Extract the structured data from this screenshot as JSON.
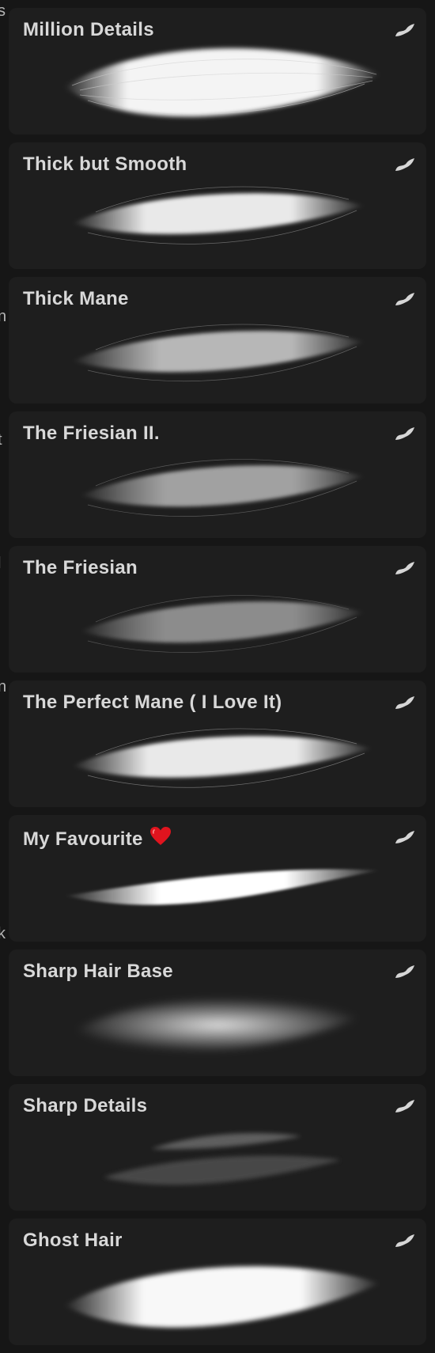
{
  "left_strip": [
    "s",
    "n",
    "t",
    "l",
    "n",
    "k"
  ],
  "brushes": [
    {
      "name": "Million Details",
      "icon": "procreate-brush-icon"
    },
    {
      "name": "Thick but Smooth",
      "icon": "procreate-brush-icon"
    },
    {
      "name": "Thick Mane",
      "icon": "procreate-brush-icon"
    },
    {
      "name": "The Friesian II.",
      "icon": "procreate-brush-icon"
    },
    {
      "name": "The Friesian",
      "icon": "procreate-brush-icon"
    },
    {
      "name": "The Perfect Mane ( I Love It)",
      "icon": "procreate-brush-icon"
    },
    {
      "name": "My Favourite",
      "icon": "procreate-brush-icon",
      "emoji": "heart-icon"
    },
    {
      "name": "Sharp Hair Base",
      "icon": "procreate-brush-icon"
    },
    {
      "name": "Sharp Details",
      "icon": "procreate-brush-icon"
    },
    {
      "name": "Ghost Hair",
      "icon": "procreate-brush-icon"
    }
  ],
  "colors": {
    "background": "#161616",
    "card": "#1e1e1e",
    "text": "#d8d8d8",
    "heart": "#e0141e"
  }
}
